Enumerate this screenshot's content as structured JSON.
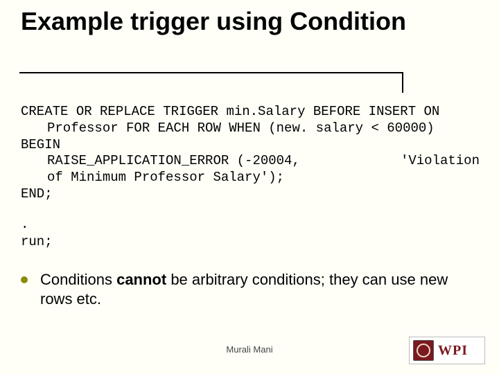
{
  "title": "Example trigger using Condition",
  "code": {
    "l1": "CREATE OR REPLACE TRIGGER min.Salary BEFORE INSERT ON",
    "l2": "Professor FOR EACH ROW WHEN (new. salary < 60000)",
    "l3": "BEGIN",
    "l4a": "RAISE_APPLICATION_ERROR (-20004,",
    "l4b": "'Violation",
    "l5": "of Minimum Professor Salary');",
    "l6": "END;"
  },
  "run": {
    "dot": ".",
    "run": "run;"
  },
  "bullet": {
    "pre": "Conditions ",
    "bold": "cannot",
    "post": " be arbitrary conditions; they can use new rows etc."
  },
  "footer": "Murali Mani",
  "logo_text": "WPI"
}
